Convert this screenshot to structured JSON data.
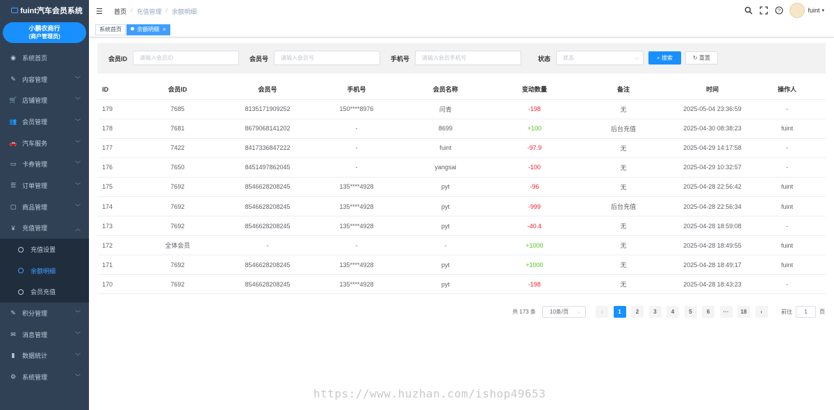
{
  "app": {
    "title": "fuint汽车会员系统"
  },
  "merchant": {
    "name": "小鹏农商行",
    "role": "(商户管理员)"
  },
  "menu": [
    {
      "label": "系统首页",
      "icon": "dashboard-icon",
      "glyph": "◉"
    },
    {
      "label": "内容管理",
      "icon": "edit-icon",
      "glyph": "✎"
    },
    {
      "label": "店铺管理",
      "icon": "cart-icon",
      "glyph": "🛒"
    },
    {
      "label": "会员管理",
      "icon": "users-icon",
      "glyph": "👥"
    },
    {
      "label": "汽车服务",
      "icon": "car-icon",
      "glyph": "🚗"
    },
    {
      "label": "卡券管理",
      "icon": "ticket-icon",
      "glyph": "▭"
    },
    {
      "label": "订单管理",
      "icon": "list-icon",
      "glyph": "☰"
    },
    {
      "label": "商品管理",
      "icon": "monitor-icon",
      "glyph": "▢"
    },
    {
      "label": "充值管理",
      "icon": "yen-icon",
      "glyph": "¥"
    },
    {
      "label": "积分管理",
      "icon": "points-icon",
      "glyph": "✎"
    },
    {
      "label": "消息管理",
      "icon": "message-icon",
      "glyph": "✉"
    },
    {
      "label": "数据统计",
      "icon": "chart-icon",
      "glyph": "▮"
    },
    {
      "label": "系统管理",
      "icon": "gear-icon",
      "glyph": "⚙"
    }
  ],
  "submenu": [
    {
      "label": "充值设置",
      "active": false
    },
    {
      "label": "余额明细",
      "active": true
    },
    {
      "label": "会员充值",
      "active": false
    }
  ],
  "breadcrumb": [
    "首页",
    "充值管理",
    "余额明细"
  ],
  "user": {
    "name": "fuint"
  },
  "tags": [
    {
      "label": "系统首页",
      "active": false
    },
    {
      "label": "余额明细",
      "active": true,
      "close": "×"
    }
  ],
  "filters": {
    "member_id_label": "会员ID",
    "member_id_placeholder": "请输入会员ID",
    "member_no_label": "会员号",
    "member_no_placeholder": "请输入会员号",
    "mobile_label": "手机号",
    "mobile_placeholder": "请输入会员手机号",
    "status_label": "状态",
    "status_placeholder": "状态",
    "search_label": "搜索",
    "reset_label": "重置"
  },
  "table": {
    "columns": [
      "ID",
      "会员ID",
      "会员号",
      "手机号",
      "会员名称",
      "变动数量",
      "备注",
      "时间",
      "操作人"
    ],
    "rows": [
      [
        "179",
        "7685",
        "8135171909252",
        "150****8976",
        "闫青",
        "-198",
        "无",
        "2025-05-04 23:36:59",
        "-"
      ],
      [
        "178",
        "7681",
        "8679068141202",
        "-",
        "8699",
        "+100",
        "后台充值",
        "2025-04-30 08:38:23",
        "fuint"
      ],
      [
        "177",
        "7422",
        "8417336847222",
        "-",
        "fuint",
        "-97.9",
        "无",
        "2025-04-29 14:17:58",
        "-"
      ],
      [
        "176",
        "7650",
        "8451497862045",
        "-",
        "yangsai",
        "-100",
        "无",
        "2025-04-29 10:32:57",
        "-"
      ],
      [
        "175",
        "7692",
        "8546628208245",
        "135****4928",
        "pyt",
        "-96",
        "无",
        "2025-04-28 22:56:42",
        "fuint"
      ],
      [
        "174",
        "7692",
        "8546628208245",
        "135****4928",
        "pyt",
        "-999",
        "后台充值",
        "2025-04-28 22:56:34",
        "fuint"
      ],
      [
        "173",
        "7692",
        "8546628208245",
        "135****4928",
        "pyt",
        "-40.4",
        "无",
        "2025-04-28 18:59:08",
        "-"
      ],
      [
        "172",
        "全体会员",
        "-",
        "-",
        "-",
        "+1000",
        "无",
        "2025-04-28 18:49:55",
        "fuint"
      ],
      [
        "171",
        "7692",
        "8546628208245",
        "135****4928",
        "pyt",
        "+1000",
        "无",
        "2025-04-28 18:49:17",
        "fuint"
      ],
      [
        "170",
        "7692",
        "8546628208245",
        "135****4928",
        "pyt",
        "-198",
        "无",
        "2025-04-28 18:43:23",
        "-"
      ]
    ]
  },
  "pagination": {
    "total_text": "共 173 条",
    "page_size": "10条/页",
    "prev": "‹",
    "next": "›",
    "pages": [
      "1",
      "2",
      "3",
      "4",
      "5",
      "6",
      "···",
      "18"
    ],
    "current": "1",
    "goto_label": "前往",
    "goto_value": "1",
    "page_unit": "页"
  },
  "colors": {
    "sidebar": "#304156",
    "primary": "#1890ff",
    "negative": "#f5222d",
    "positive": "#52c41a"
  },
  "watermark": "https://www.huzhan.com/ishop49653"
}
